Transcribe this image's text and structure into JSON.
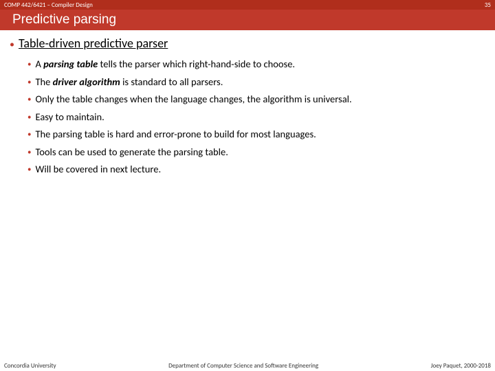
{
  "topbar": {
    "course": "COMP 442/6421 – Compiler Design",
    "page": "35"
  },
  "title": "Predictive parsing",
  "heading": "Table-driven predictive parser",
  "bullets": [
    {
      "pre": "A ",
      "bold": "parsing table",
      "post": " tells the parser which right-hand-side to choose."
    },
    {
      "pre": "The ",
      "bold": "driver algorithm",
      "post": " is standard to all parsers."
    },
    {
      "pre": "",
      "bold": "",
      "post": "Only the table changes when the language changes, the algorithm is universal."
    },
    {
      "pre": "",
      "bold": "",
      "post": "Easy to maintain."
    },
    {
      "pre": "",
      "bold": "",
      "post": "The parsing table is hard and error-prone to build for most languages."
    },
    {
      "pre": "",
      "bold": "",
      "post": "Tools can be used to generate the parsing table."
    },
    {
      "pre": "",
      "bold": "",
      "post": "Will be covered in next lecture."
    }
  ],
  "footer": {
    "left": "Concordia University",
    "center": "Department of Computer Science and Software Engineering",
    "right": "Joey Paquet, 2000-2018"
  }
}
